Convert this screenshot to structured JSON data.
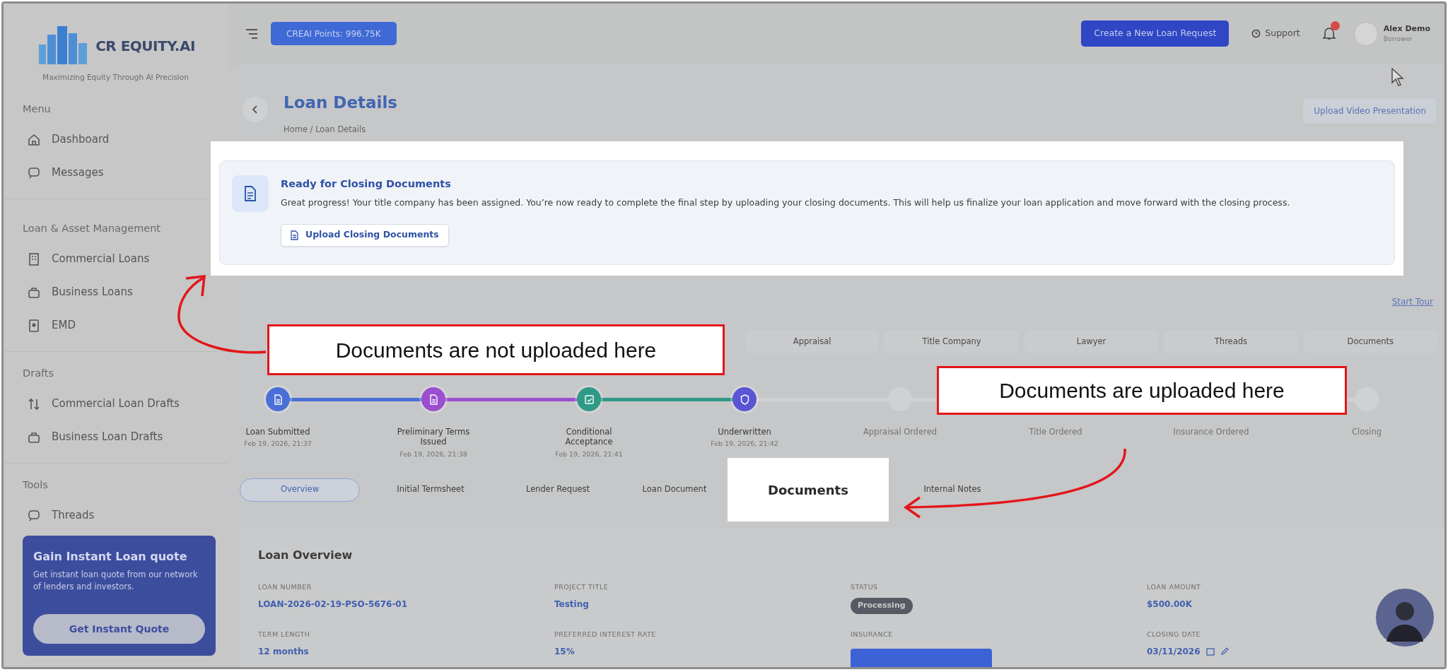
{
  "brand": {
    "name": "CR EQUITY.AI",
    "tagline": "Maximizing Equity Through AI Precision"
  },
  "sidebar": {
    "sections": [
      {
        "heading": "Menu",
        "items": [
          {
            "label": "Dashboard"
          },
          {
            "label": "Messages"
          }
        ]
      },
      {
        "heading": "Loan & Asset Management",
        "items": [
          {
            "label": "Commercial Loans"
          },
          {
            "label": "Business Loans"
          },
          {
            "label": "EMD"
          }
        ]
      },
      {
        "heading": "Drafts",
        "items": [
          {
            "label": "Commercial Loan Drafts"
          },
          {
            "label": "Business Loan Drafts"
          }
        ]
      },
      {
        "heading": "Tools",
        "items": [
          {
            "label": "Threads"
          }
        ]
      }
    ]
  },
  "promo": {
    "title": "Gain Instant Loan quote",
    "text": "Get instant loan quote from our network of lenders and investors.",
    "button": "Get Instant Quote"
  },
  "topbar": {
    "points": "CREAI Points: 996.75K",
    "new_request": "Create a New Loan Request",
    "support": "Support",
    "user": {
      "name": "Alex Demo",
      "role": "Borrower"
    }
  },
  "page": {
    "title": "Loan Details",
    "breadcrumb": "Home / Loan Details",
    "upload_video": "Upload Video Presentation"
  },
  "notice": {
    "title": "Ready for Closing Documents",
    "text": "Great progress! Your title company has been assigned. You’re now ready to complete the final step by uploading your closing documents. This will help us finalize your loan application and move forward with the closing process.",
    "button": "Upload Closing Documents"
  },
  "start_tour": "Start Tour",
  "tabs": [
    {
      "label": "Appraisal",
      "selected": false
    },
    {
      "label": "Title Company",
      "selected": false
    },
    {
      "label": "Lawyer",
      "selected": false
    },
    {
      "label": "Threads",
      "selected": false
    },
    {
      "label": "Documents",
      "selected": false
    }
  ],
  "steps": [
    {
      "label": "Loan Submitted",
      "date": "Feb 19, 2026, 21:37",
      "done": true,
      "color": "#4a6fd6"
    },
    {
      "label": "Preliminary Terms Issued",
      "date": "Feb 19, 2026, 21:38",
      "done": true,
      "color": "#9b4fd0"
    },
    {
      "label": "Conditional Acceptance",
      "date": "Feb 19, 2026, 21:41",
      "done": true,
      "color": "#2e9a86"
    },
    {
      "label": "Underwritten",
      "date": "Feb 19, 2026, 21:42",
      "done": true,
      "color": "#5a55d4"
    },
    {
      "label": "Appraisal Ordered",
      "done": false
    },
    {
      "label": "Title Ordered",
      "done": false
    },
    {
      "label": "Insurance Ordered",
      "done": false
    },
    {
      "label": "Closing",
      "done": false
    }
  ],
  "subtabs": [
    {
      "label": "Overview",
      "selected": true,
      "spotlight": false
    },
    {
      "label": "Initial Termsheet",
      "selected": false,
      "spotlight": false
    },
    {
      "label": "Lender Request",
      "selected": false,
      "spotlight": false
    },
    {
      "label": "Loan Document",
      "selected": false,
      "spotlight": false
    },
    {
      "label": "Documents",
      "selected": false,
      "spotlight": true
    },
    {
      "label": "Internal Notes",
      "selected": false,
      "spotlight": false
    }
  ],
  "overview": {
    "title": "Loan Overview",
    "fields": [
      {
        "label": "LOAN NUMBER",
        "value": "LOAN-2026-02-19-PSO-5676-01",
        "kind": "link"
      },
      {
        "label": "PROJECT TITLE",
        "value": "Testing",
        "kind": "link"
      },
      {
        "label": "STATUS",
        "value": "Processing",
        "kind": "badge"
      },
      {
        "label": "LOAN AMOUNT",
        "value": "$500.00K",
        "kind": "link"
      },
      {
        "label": "TERM LENGTH",
        "value": "12 months",
        "kind": "link"
      },
      {
        "label": "PREFERRED INTEREST RATE",
        "value": "15%",
        "kind": "link"
      },
      {
        "label": "INSURANCE",
        "kind": "button"
      },
      {
        "label": "CLOSING DATE",
        "value": "03/11/2026",
        "kind": "date"
      }
    ]
  },
  "callouts": [
    {
      "text": "Documents are not uploaded here"
    },
    {
      "text": "Documents are uploaded here"
    }
  ]
}
